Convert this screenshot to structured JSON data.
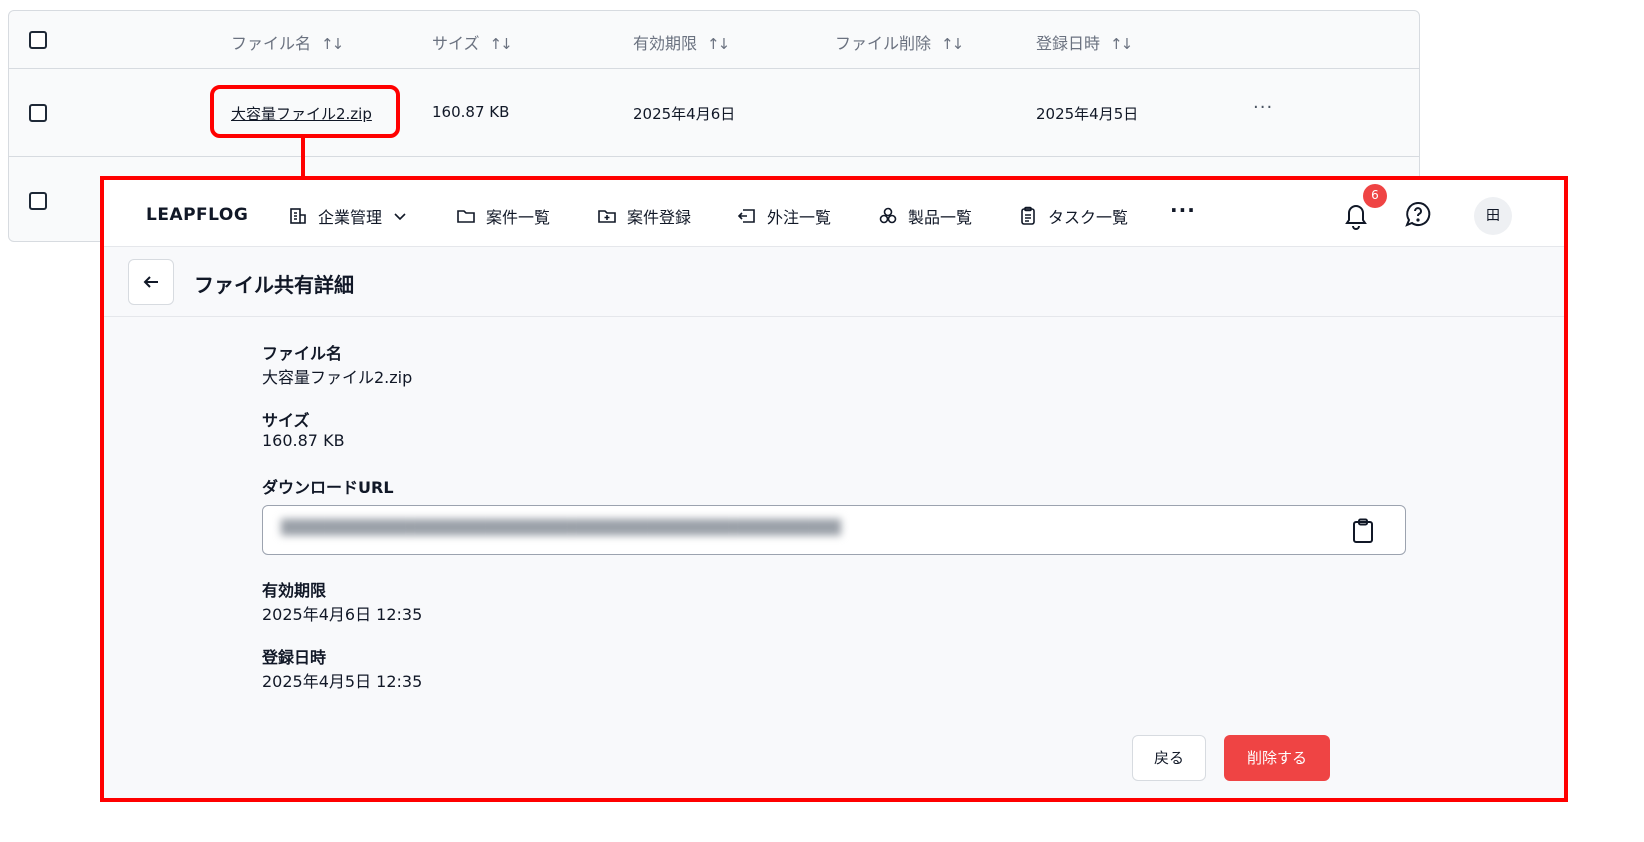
{
  "file_table": {
    "columns": [
      {
        "label": "ファイル名"
      },
      {
        "label": "サイズ"
      },
      {
        "label": "有効期限"
      },
      {
        "label": "ファイル削除"
      },
      {
        "label": "登録日時"
      }
    ],
    "rows": [
      {
        "file_name": "大容量ファイル2.zip",
        "size": "160.87 KB",
        "expiry": "2025年4月6日",
        "deletion": "",
        "registered": "2025年4月5日"
      }
    ],
    "sort_icon": "sort-arrows-icon",
    "row_menu": "···"
  },
  "nav": {
    "brand": "LEAPFLOG",
    "items": [
      {
        "label": "企業管理",
        "icon": "building-icon"
      },
      {
        "label": "案件一覧",
        "icon": "folder-icon"
      },
      {
        "label": "案件登録",
        "icon": "folder-plus-icon"
      },
      {
        "label": "外注一覧",
        "icon": "outsource-icon"
      },
      {
        "label": "製品一覧",
        "icon": "products-icon"
      },
      {
        "label": "タスク一覧",
        "icon": "clipboard-list-icon"
      }
    ],
    "more": "···",
    "notification_count": "6",
    "avatar": "田"
  },
  "detail": {
    "title": "ファイル共有詳細",
    "file_name_label": "ファイル名",
    "file_name": "大容量ファイル2.zip",
    "size_label": "サイズ",
    "size": "160.87 KB",
    "url_label": "ダウンロードURL",
    "expiry_label": "有効期限",
    "expiry": "2025年4月6日 12:35",
    "registered_label": "登録日時",
    "registered": "2025年4月5日 12:35",
    "back_button": "戻る",
    "delete_button": "削除する"
  },
  "colors": {
    "accent_red": "#ef4444",
    "annotation_red": "#ff0000"
  }
}
